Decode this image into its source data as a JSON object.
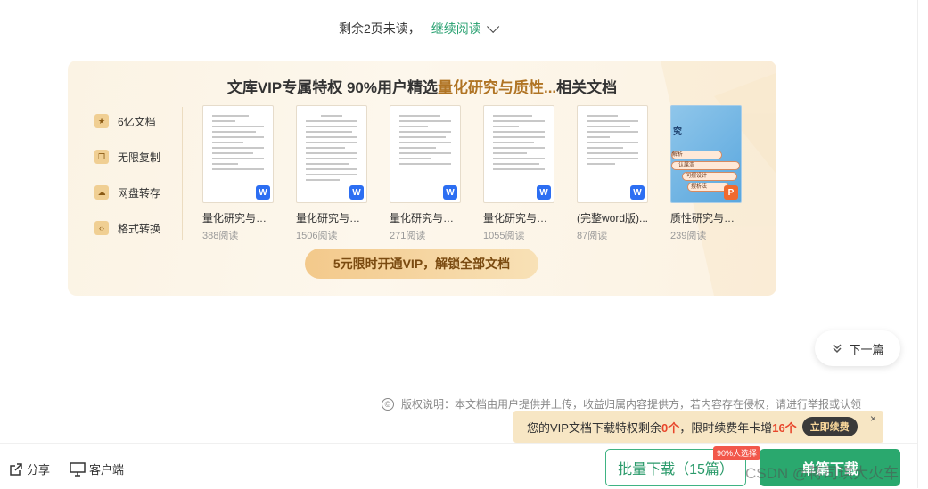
{
  "top": {
    "remaining": "剩余2页未读，",
    "continue": "继续阅读"
  },
  "vip_panel": {
    "title_prefix": "文库VIP专属特权 90%用户精选",
    "title_highlight": "量化研究与质性...",
    "title_suffix": "相关文档",
    "features": [
      {
        "label": "6亿文档",
        "icon": "star-icon"
      },
      {
        "label": "无限复制",
        "icon": "copy-icon"
      },
      {
        "label": "网盘转存",
        "icon": "cloud-icon"
      },
      {
        "label": "格式转换",
        "icon": "code-icon"
      }
    ],
    "docs": [
      {
        "name": "量化研究与质...",
        "reads": "388阅读",
        "badge": "W"
      },
      {
        "name": "量化研究与质...",
        "reads": "1506阅读",
        "badge": "W"
      },
      {
        "name": "量化研究与质...",
        "reads": "271阅读",
        "badge": "W"
      },
      {
        "name": "量化研究与质...",
        "reads": "1055阅读",
        "badge": "W"
      },
      {
        "name": "(完整word版)...",
        "reads": "87阅读",
        "badge": "W"
      },
      {
        "name": "质性研究与量...",
        "reads": "239阅读",
        "badge": "P"
      }
    ],
    "ppt_thumb_text": [
      "究",
      "解析",
      "认属浩",
      "问摆设计",
      "搜析法"
    ],
    "cta": "5元限时开通VIP，解锁全部文档"
  },
  "next": {
    "label": "下一篇"
  },
  "copyright": {
    "icon": "©",
    "text": "版权说明：本文档由用户提供并上传，收益归属内容提供方，若内容存在侵权，请进行举报或认领"
  },
  "vip_tip": {
    "part1": "您的VIP文档下载特权剩余",
    "count": "0个",
    "part2": "，限时续费年卡增",
    "bonus": "16个",
    "renew": "立即续费",
    "close": "×"
  },
  "bottom": {
    "share": "分享",
    "client": "客户端",
    "batch": "批量下载（15篇）",
    "tag": "90%人选择",
    "single": "单篇下载"
  },
  "watermark": "CSDN @蒋司琪大火车",
  "colors": {
    "accent_green": "#2aa86e",
    "vip_gold": "#b07424",
    "alert_red": "#e8462b"
  }
}
